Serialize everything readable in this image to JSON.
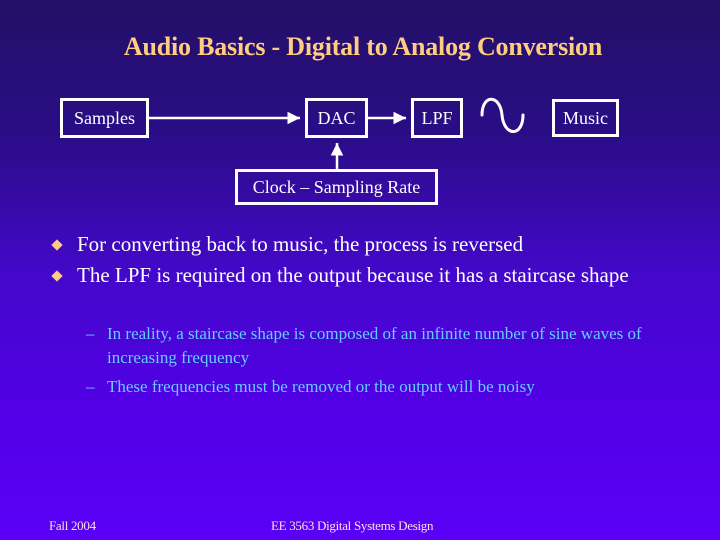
{
  "title": "Audio Basics - Digital to Analog Conversion",
  "diagram": {
    "nodes": {
      "samples": "Samples",
      "dac": "DAC",
      "lpf": "LPF",
      "music": "Music",
      "clock": "Clock – Sampling Rate"
    },
    "edges": [
      {
        "from": "samples",
        "to": "dac"
      },
      {
        "from": "dac",
        "to": "lpf"
      },
      {
        "from": "clock",
        "to": "dac"
      }
    ],
    "output_symbol": "sine-wave"
  },
  "bullets": [
    {
      "text": "For converting back to music, the process is reversed"
    },
    {
      "text": "The LPF is required on the output because it has a staircase shape"
    }
  ],
  "sub_bullets": [
    {
      "marker": "–",
      "text": "In reality, a staircase shape is composed of an infinite number of sine waves of increasing frequency"
    },
    {
      "marker": "–",
      "text": "These frequencies must be removed or the output will be noisy"
    }
  ],
  "footer": {
    "left": "Fall 2004",
    "center": "EE 3563 Digital Systems Design"
  },
  "colors": {
    "title": "#ffcc80",
    "bullet_marker": "#ffcc88",
    "sub_bullet_text": "#66ccff",
    "body_text": "#ffffff"
  }
}
